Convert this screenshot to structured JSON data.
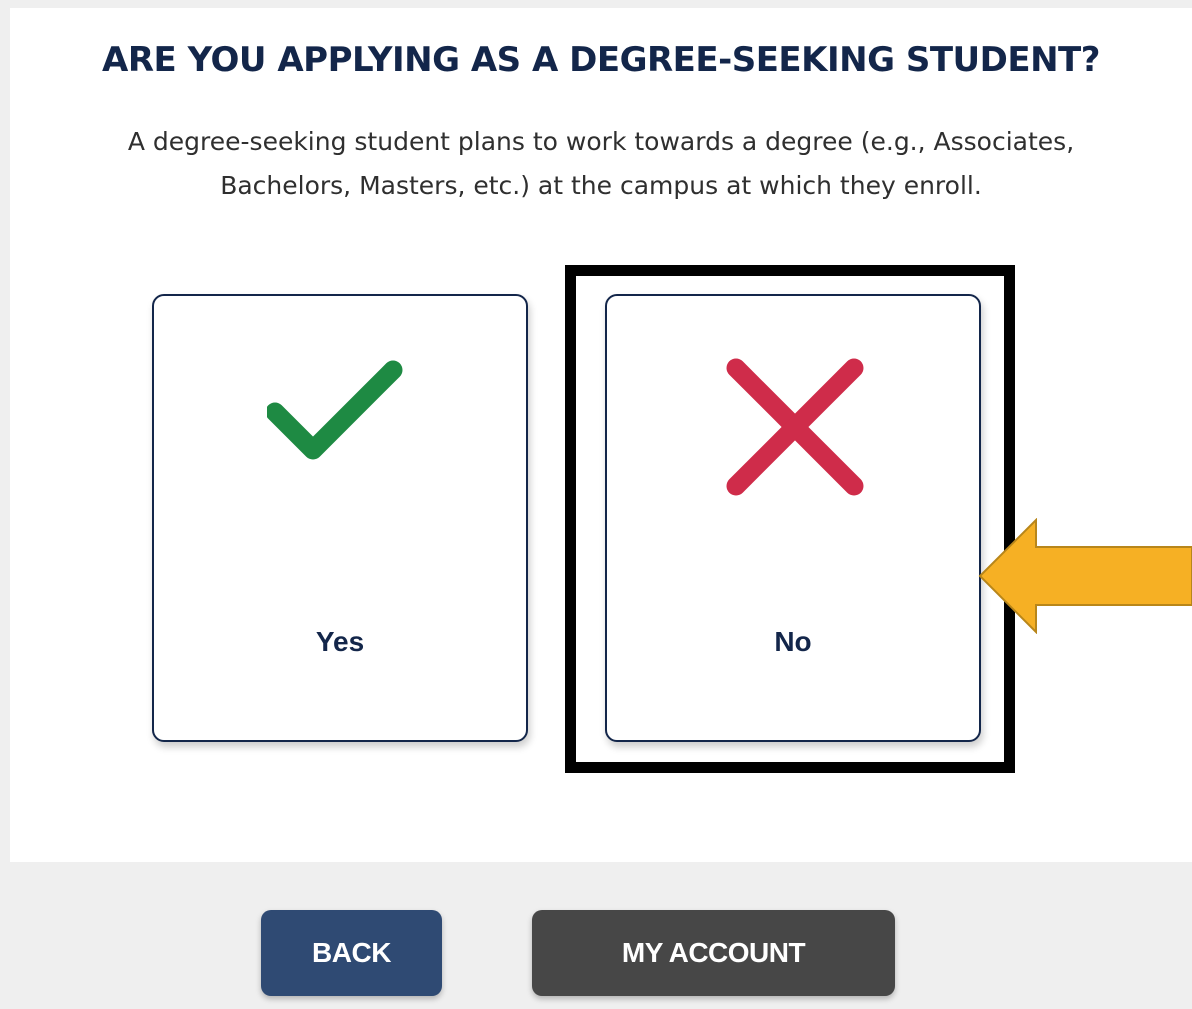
{
  "question": {
    "title": "ARE YOU APPLYING AS A DEGREE-SEEKING STUDENT?",
    "description_line1": "A degree-seeking student plans to work towards a degree (e.g., Associates,",
    "description_line2": "Bachelors, Masters, etc.) at the campus at which they enroll."
  },
  "options": [
    {
      "label": "Yes",
      "icon": "checkmark-icon",
      "color": "#1e8a43"
    },
    {
      "label": "No",
      "icon": "x-icon",
      "color": "#cf2c4a"
    }
  ],
  "annotation": {
    "highlight_color": "#000000",
    "arrow_color": "#f6b024",
    "arrow_border": "#b8861a",
    "highlighted_option": "No"
  },
  "footer": {
    "back_label": "BACK",
    "account_label": "MY ACCOUNT"
  },
  "colors": {
    "navy": "#13264a",
    "back_button": "#2f4a73",
    "account_button": "#474747"
  }
}
